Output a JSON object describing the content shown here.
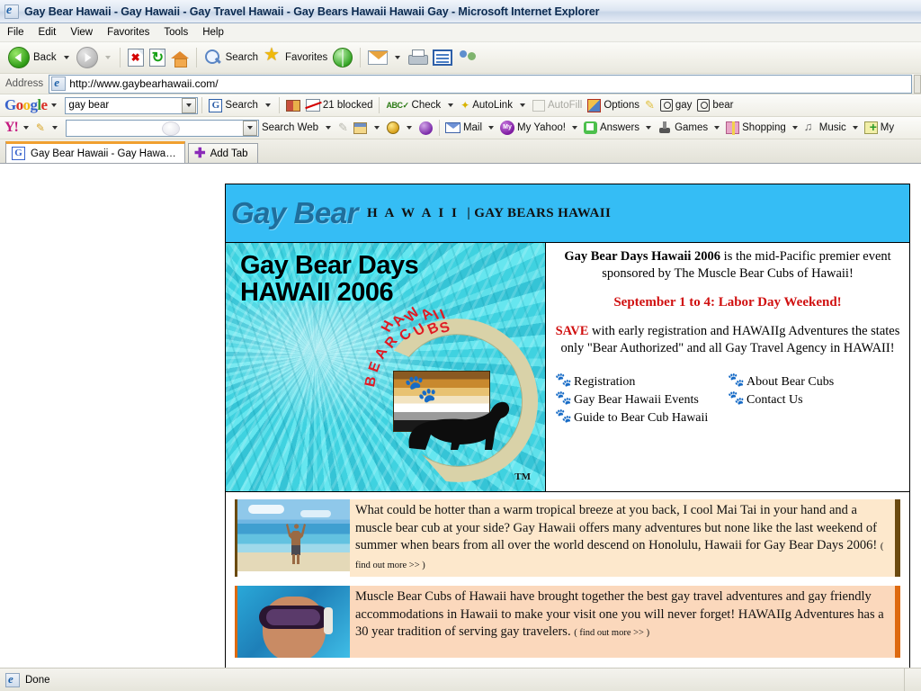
{
  "window": {
    "title": "Gay Bear Hawaii - Gay Hawaii - Gay Travel Hawaii - Gay Bears Hawaii Hawaii Gay - Microsoft Internet Explorer",
    "app_icon": "ie-icon"
  },
  "menubar": {
    "items": [
      "File",
      "Edit",
      "View",
      "Favorites",
      "Tools",
      "Help"
    ]
  },
  "toolbar": {
    "back_label": "Back",
    "search_label": "Search",
    "favorites_label": "Favorites",
    "icons": [
      "back-icon",
      "forward-icon",
      "stop-icon",
      "refresh-icon",
      "home-icon",
      "search-icon",
      "favorites-icon",
      "history-icon",
      "mail-icon",
      "print-icon",
      "edit-icon",
      "messenger-icon"
    ]
  },
  "address": {
    "label": "Address",
    "url": "http://www.gaybearhawaii.com/",
    "placeholder": "http://"
  },
  "google_toolbar": {
    "logo": "Google",
    "query": "gay bear",
    "search_label": "Search",
    "blocked_label": "21 blocked",
    "check_label": "Check",
    "autolink_label": "AutoLink",
    "autofill_label": "AutoFill",
    "options_label": "Options",
    "highlight_icon": "highlighter-icon",
    "term1": "gay",
    "term2": "bear"
  },
  "yahoo_toolbar": {
    "logo": "Y!",
    "query": "",
    "search_web_label": "Search Web",
    "items": [
      {
        "label": "Mail",
        "icon": "mail-icon"
      },
      {
        "label": "My Yahoo!",
        "icon": "my-yahoo-icon"
      },
      {
        "label": "Answers",
        "icon": "answers-icon"
      },
      {
        "label": "Games",
        "icon": "games-icon"
      },
      {
        "label": "Shopping",
        "icon": "shopping-icon"
      },
      {
        "label": "Music",
        "icon": "music-icon"
      },
      {
        "label": "My",
        "icon": "add-icon"
      }
    ]
  },
  "tabs": {
    "active": "Gay Bear Hawaii - Gay Hawaii - ...",
    "add_tab_label": "Add Tab"
  },
  "page": {
    "banner": {
      "brand": "Gay Bear",
      "sub1": "H A W A I I",
      "sub2": "| GAY BEARS HAWAII",
      "bg_color": "#35bdf5"
    },
    "hero_image": {
      "title_line1": "Gay Bear Days",
      "title_line2": "HAWAII 2006",
      "arc_text": "HAWAII BEAR CUBS",
      "trademark": "TM"
    },
    "intro": {
      "headline_bold": "Gay Bear Days Hawaii 2006",
      "headline_rest": " is the mid-Pacific premier event sponsored by The Muscle Bear Cubs of Hawaii!",
      "date_line": "September 1 to 4: Labor Day Weekend!",
      "save_word": "SAVE",
      "save_rest": " with early registration and HAWAIIg Adventures the states only \"Bear Authorized\" and all Gay Travel Agency in HAWAII!",
      "date_color": "#d01010"
    },
    "links": {
      "left": [
        "Registration",
        "Gay Bear Hawaii Events",
        "Guide to Bear Cub Hawaii"
      ],
      "right": [
        "About Bear Cubs",
        "Contact Us"
      ]
    },
    "promos": [
      {
        "image": "beach-man-photo",
        "text": "What could be hotter than a warm tropical breeze at you back, I cool Mai Tai in your hand and a muscle bear cub at your side?  Gay Hawaii offers many adventures but none like the last weekend of summer when bears from all over the world descend on Honolulu, Hawaii for Gay Bear Days 2006!",
        "more": "( find out more >> )",
        "accent": "#6b4a10",
        "bg": "#fde8cc"
      },
      {
        "image": "snorkel-man-photo",
        "text": "Muscle Bear Cubs of Hawaii have brought together the best gay travel adventures and gay friendly accommodations in Hawaii to make your visit one you will never forget!  HAWAIIg Adventures has a 30 year tradition of serving gay travelers.",
        "more": "( find out more >> )",
        "accent": "#de6a10",
        "bg": "#fbd8bc"
      }
    ]
  },
  "status": {
    "text": "Done",
    "icon": "ie-icon"
  }
}
